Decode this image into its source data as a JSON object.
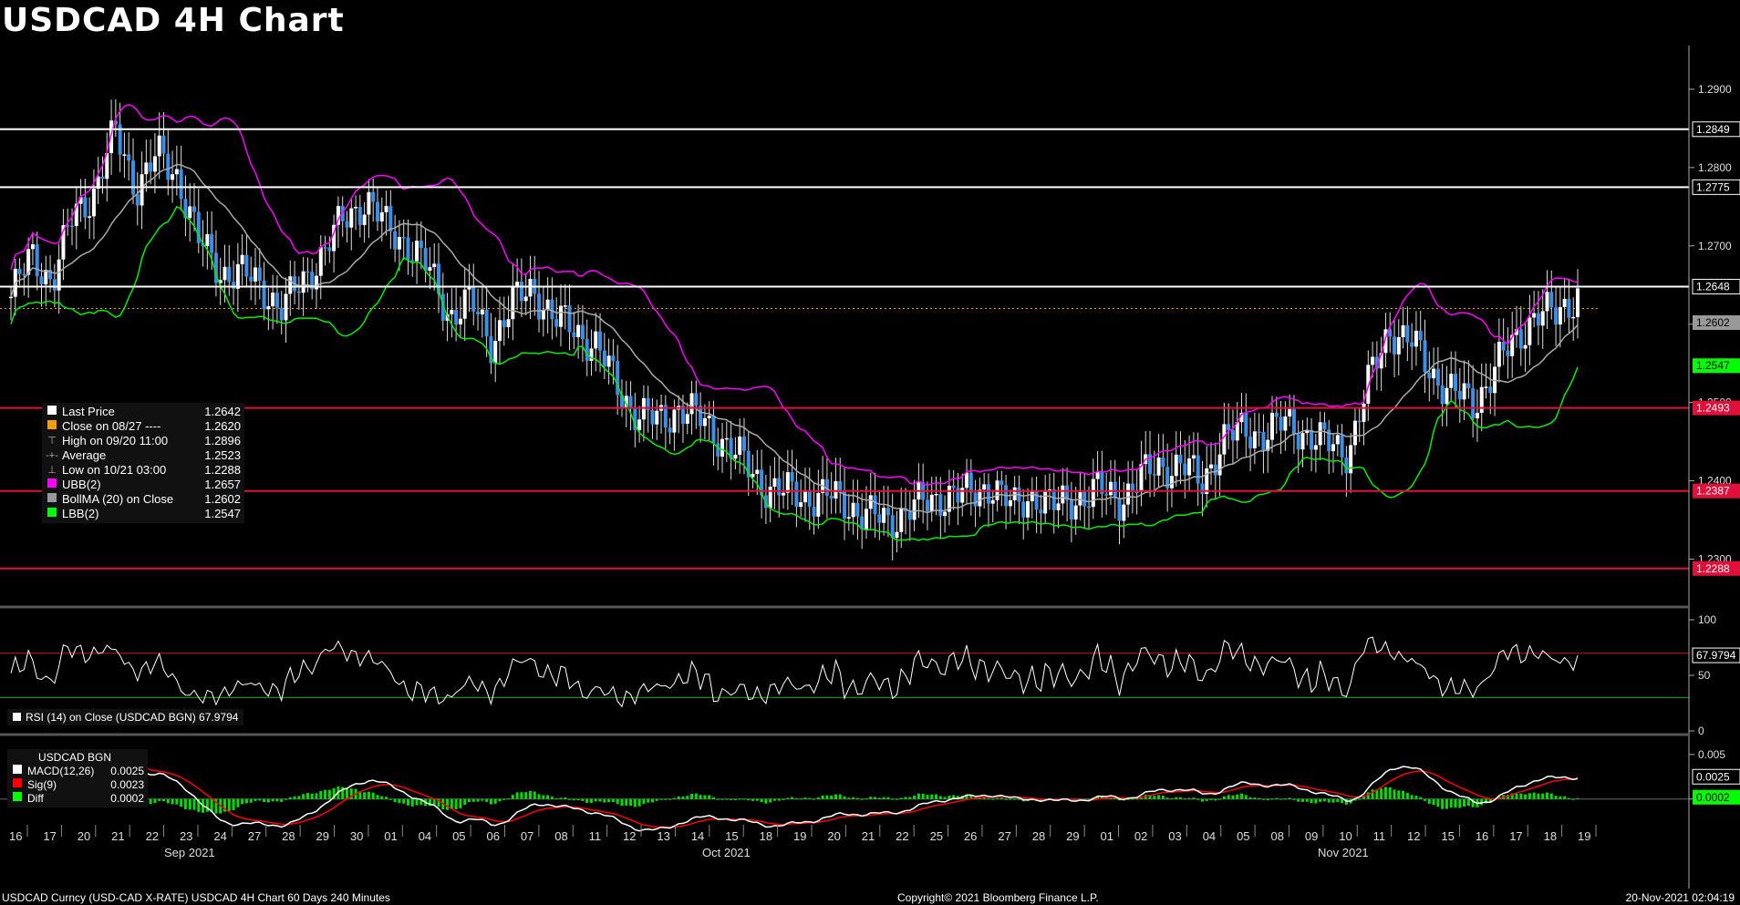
{
  "title": "USDCAD 4H Chart",
  "footer": {
    "left": "USDCAD Curncy (USD-CAD X-RATE) USDCAD 4H Chart 60 Days 240 Minutes",
    "center": "Copyright© 2021 Bloomberg Finance L.P.",
    "right": "20-Nov-2021 02:04:19"
  },
  "legend_price": [
    {
      "label": "Last Price",
      "value": "1.2642",
      "color": "#ffffff",
      "sym": "square"
    },
    {
      "label": "Close on 08/27 ----",
      "value": "1.2620",
      "color": "#f39c12",
      "sym": "square"
    },
    {
      "label": "High on 09/20 11:00",
      "value": "1.2896",
      "color": "#aaaaaa",
      "sym": "⊤"
    },
    {
      "label": "Average",
      "value": "1.2523",
      "color": "#aaaaaa",
      "sym": "-+-"
    },
    {
      "label": "Low on 10/21 03:00",
      "value": "1.2288",
      "color": "#aaaaaa",
      "sym": "⊥"
    },
    {
      "label": "UBB(2)",
      "value": "1.2657",
      "color": "#ff00ff",
      "sym": "square"
    },
    {
      "label": "BollMA (20)  on Close",
      "value": "1.2602",
      "color": "#999999",
      "sym": "square"
    },
    {
      "label": "LBB(2)",
      "value": "1.2547",
      "color": "#00ff00",
      "sym": "square"
    }
  ],
  "legend_rsi": {
    "label": "RSI (14)  on Close (USDCAD BGN) 67.9794"
  },
  "legend_macd": {
    "heading": "USDCAD BGN",
    "rows": [
      {
        "label": "MACD(12,26)",
        "value": "0.0025",
        "color": "#ffffff"
      },
      {
        "label": "Sig(9)",
        "value": "0.0023",
        "color": "#ff0000"
      },
      {
        "label": "Diff",
        "value": "0.0002",
        "color": "#00ff00"
      }
    ]
  },
  "chart_data": [
    {
      "type": "candlestick",
      "panel": "price",
      "y_ticks": [
        "1.2900",
        "1.2800",
        "1.2700",
        "1.2600",
        "1.2500",
        "1.2400",
        "1.2300"
      ],
      "ylim": [
        1.224,
        1.295
      ],
      "horizontal_lines": [
        {
          "value": 1.2849,
          "label": "1.2849",
          "color": "#ffffff"
        },
        {
          "value": 1.2775,
          "label": "1.2775",
          "color": "#ffffff"
        },
        {
          "value": 1.2648,
          "label": "1.2648",
          "color": "#ffffff"
        },
        {
          "value": 1.2493,
          "label": "1.2493",
          "color": "#e0103a"
        },
        {
          "value": 1.2387,
          "label": "1.2387",
          "color": "#e0103a"
        },
        {
          "value": 1.2288,
          "label": "1.2288",
          "color": "#e0103a"
        }
      ],
      "reference_line": {
        "value": 1.262,
        "color": "#f39c12",
        "style": "dotted"
      },
      "value_markers": [
        {
          "value": 1.2602,
          "label": "1.2602",
          "color": "#999999"
        },
        {
          "value": 1.2547,
          "label": "1.2547",
          "color": "#00ff00"
        }
      ],
      "x_tick_labels": [
        "16",
        "17",
        "20",
        "21",
        "22",
        "23",
        "24",
        "27",
        "28",
        "29",
        "30",
        "01",
        "04",
        "05",
        "06",
        "07",
        "08",
        "11",
        "12",
        "13",
        "14",
        "15",
        "18",
        "19",
        "20",
        "21",
        "22",
        "25",
        "26",
        "27",
        "28",
        "29",
        "01",
        "02",
        "03",
        "04",
        "05",
        "08",
        "09",
        "10",
        "11",
        "12",
        "15",
        "16",
        "17",
        "18",
        "19"
      ],
      "x_month_labels": [
        "Sep 2021",
        "Oct 2021",
        "Nov 2021"
      ],
      "close_profile": [
        1.2635,
        1.2688,
        1.2655,
        1.274,
        1.277,
        1.2845,
        1.2775,
        1.2815,
        1.279,
        1.2705,
        1.2668,
        1.2665,
        1.2648,
        1.262,
        1.2655,
        1.2695,
        1.2735,
        1.276,
        1.2722,
        1.2705,
        1.2668,
        1.2612,
        1.2628,
        1.2578,
        1.2625,
        1.2648,
        1.2605,
        1.2595,
        1.2572,
        1.2522,
        1.2485,
        1.2475,
        1.2495,
        1.2478,
        1.2455,
        1.2425,
        1.2395,
        1.2385,
        1.238,
        1.2382,
        1.237,
        1.2358,
        1.2345,
        1.2368,
        1.237,
        1.2388,
        1.2378,
        1.2398,
        1.2362,
        1.2385,
        1.2365,
        1.2378,
        1.2388,
        1.2375,
        1.2402,
        1.2418,
        1.2422,
        1.2395,
        1.2455,
        1.2462,
        1.2462,
        1.2472,
        1.2462,
        1.2445,
        1.2438,
        1.2525,
        1.2595,
        1.2578,
        1.2538,
        1.2515,
        1.2495,
        1.2545,
        1.2575,
        1.2618,
        1.2608,
        1.2642
      ],
      "series_legend": [
        "UBB(2)",
        "BollMA (20)",
        "LBB(2)"
      ]
    },
    {
      "type": "line",
      "panel": "rsi",
      "name": "RSI (14)",
      "y_ticks": [
        "100",
        "50",
        "0"
      ],
      "ylim": [
        0,
        100
      ],
      "overbought": 70,
      "oversold": 30,
      "last": 67.9794,
      "last_label": "67.9794"
    },
    {
      "type": "bar+line",
      "panel": "macd",
      "y_ticks": [
        "0.005",
        "0"
      ],
      "ylim": [
        -0.008,
        0.006
      ],
      "markers": [
        {
          "value": 0.0025,
          "label": "0.0025",
          "color": "#ffffff"
        },
        {
          "value": 0.0002,
          "label": "0.0002",
          "color": "#00ff00"
        }
      ]
    }
  ]
}
